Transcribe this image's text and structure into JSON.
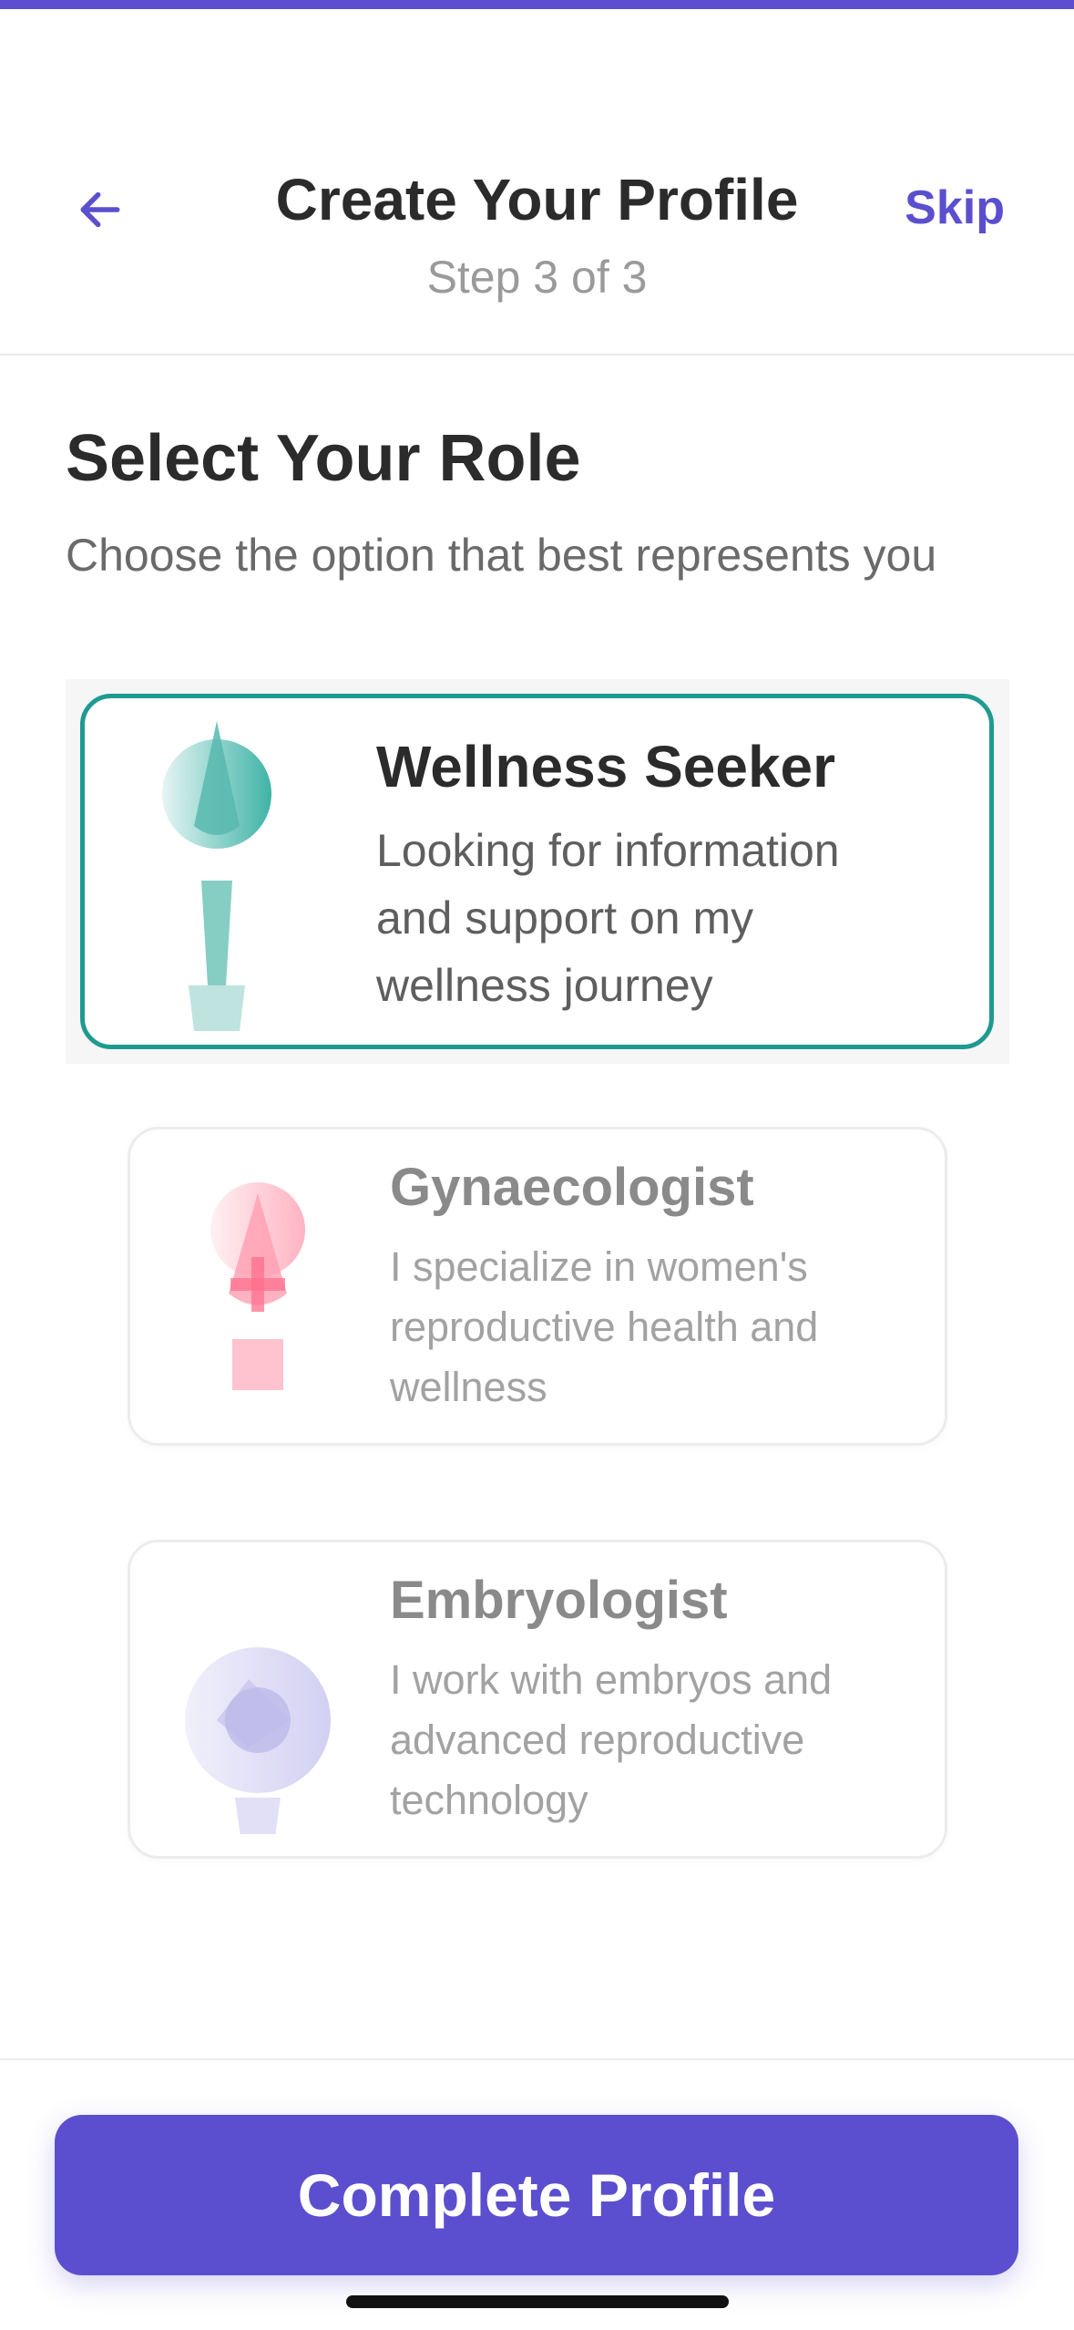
{
  "progress": {
    "step": 3,
    "total": 3,
    "fraction": 1.0
  },
  "header": {
    "title": "Create Your Profile",
    "subtitle": "Step 3 of 3",
    "skip_label": "Skip",
    "back_icon": "arrow-left-icon"
  },
  "section": {
    "title": "Select Your Role",
    "description": "Choose the option that best represents you"
  },
  "roles": [
    {
      "title": "Wellness Seeker",
      "description": "Looking for information and support on my wellness journey",
      "selected": true,
      "icon": "wellness-seeker-icon",
      "color": "#1f9a90"
    },
    {
      "title": "Gynaecologist",
      "description": "I specialize in women's reproductive health and wellness",
      "selected": false,
      "icon": "gynaecologist-icon",
      "color": "#ff8fa3"
    },
    {
      "title": "Embryologist",
      "description": "I work with embryos and advanced reproductive technology",
      "selected": false,
      "icon": "embryologist-icon",
      "color": "#8f8ae0"
    }
  ],
  "cta": {
    "label": "Complete Profile"
  },
  "colors": {
    "accent": "#5b4fcf",
    "selected_border": "#1f9a90",
    "text_primary": "#2b2b2b",
    "text_secondary": "#9a9a9a"
  }
}
